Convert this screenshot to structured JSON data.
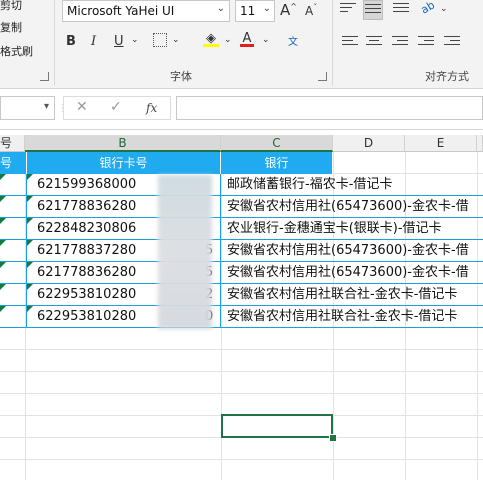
{
  "ribbon": {
    "clipboard": {
      "cut_label": "剪切",
      "copy_label": "复制",
      "format_painter_label": "格式刷"
    },
    "font": {
      "family_value": "Microsoft YaHei UI",
      "size_value": "11",
      "grow_label": "A",
      "shrink_label": "A",
      "bold_label": "B",
      "italic_label": "I",
      "underline_label": "U",
      "fill_label": "◈",
      "color_label": "A",
      "phonetic_label": "文",
      "group_label": "字体"
    },
    "alignment": {
      "group_label": "对齐方式",
      "orientation_label": "ab"
    }
  },
  "formula_bar": {
    "cancel_glyph": "✕",
    "enter_glyph": "✓",
    "fx_glyph": "fx",
    "value": ""
  },
  "grid": {
    "columns": [
      {
        "id": "A",
        "label": "号"
      },
      {
        "id": "B",
        "label": "B"
      },
      {
        "id": "C",
        "label": "C"
      },
      {
        "id": "D",
        "label": "D"
      },
      {
        "id": "E",
        "label": "E"
      }
    ],
    "header_row": {
      "a": "号",
      "b": "银行卡号",
      "c": "银行"
    },
    "rows": [
      {
        "card": "621599368000",
        "card_tail": "",
        "bank": "邮政储蓄银行-福农卡-借记卡"
      },
      {
        "card": "621778836280",
        "card_tail": "",
        "bank": "安徽省农村信用社(65473600)-金农卡-借"
      },
      {
        "card": "622848230806",
        "card_tail": "",
        "bank": "农业银行-金穗通宝卡(银联卡)-借记卡"
      },
      {
        "card": "621778837280",
        "card_tail": "5",
        "bank": "安徽省农村信用社(65473600)-金农卡-借"
      },
      {
        "card": "621778836280",
        "card_tail": "5",
        "bank": "安徽省农村信用社(65473600)-金农卡-借"
      },
      {
        "card": "622953810280",
        "card_tail": "2",
        "bank": "安徽省农村信用社联合社-金农卡-借记卡"
      },
      {
        "card": "622953810280",
        "card_tail": "0",
        "bank": "安徽省农村信用社联合社-金农卡-借记卡"
      }
    ]
  },
  "colors": {
    "header_fill": "#20aaef",
    "selection": "#217346",
    "font_color_red": "#e02020",
    "fill_yellow": "#ffff00"
  }
}
